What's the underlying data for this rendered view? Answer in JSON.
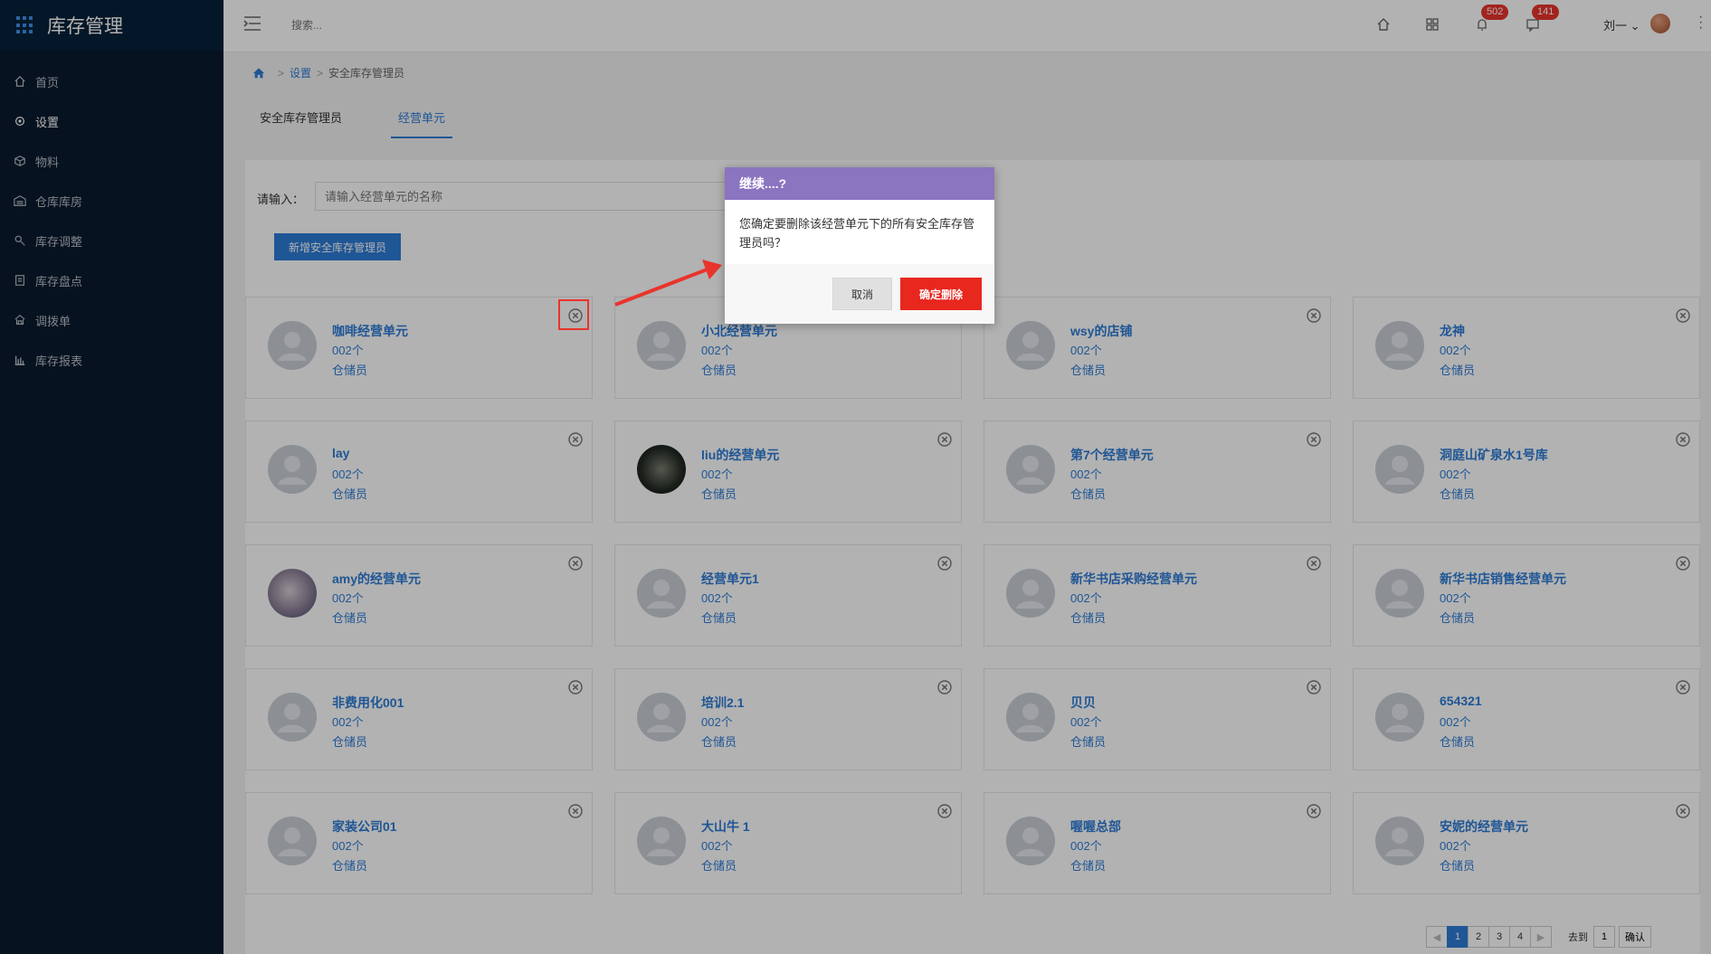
{
  "app": {
    "title": "库存管理"
  },
  "sidebar": {
    "items": [
      {
        "label": "首页",
        "icon": "home-icon"
      },
      {
        "label": "设置",
        "icon": "gear-icon"
      },
      {
        "label": "物料",
        "icon": "box-icon"
      },
      {
        "label": "仓库库房",
        "icon": "warehouse-icon"
      },
      {
        "label": "库存调整",
        "icon": "adjust-icon"
      },
      {
        "label": "库存盘点",
        "icon": "clipboard-icon"
      },
      {
        "label": "调拨单",
        "icon": "transfer-icon"
      },
      {
        "label": "库存报表",
        "icon": "bar-chart-icon"
      }
    ]
  },
  "topbar": {
    "search_placeholder": "搜索...",
    "notifications_count": "502",
    "messages_count": "141",
    "user_name": "刘一"
  },
  "breadcrumb": {
    "level1": "设置",
    "level2": "安全库存管理员"
  },
  "tabs": [
    {
      "label": "安全库存管理员"
    },
    {
      "label": "经营单元"
    }
  ],
  "filter": {
    "label": "请输入：",
    "placeholder": "请输入经营单元的名称",
    "add_button": "新增安全库存管理员"
  },
  "cards": [
    {
      "name": "咖啡经营单元",
      "count": "002个",
      "role": "仓储员",
      "avatar": "default"
    },
    {
      "name": "小北经营单元",
      "count": "002个",
      "role": "仓储员",
      "avatar": "default"
    },
    {
      "name": "wsy的店铺",
      "count": "002个",
      "role": "仓储员",
      "avatar": "default"
    },
    {
      "name": "龙神",
      "count": "002个",
      "role": "仓储员",
      "avatar": "default"
    },
    {
      "name": "lay",
      "count": "002个",
      "role": "仓储员",
      "avatar": "default"
    },
    {
      "name": "liu的经营单元",
      "count": "002个",
      "role": "仓储员",
      "avatar": "photo1"
    },
    {
      "name": "第7个经营单元",
      "count": "002个",
      "role": "仓储员",
      "avatar": "default"
    },
    {
      "name": "洞庭山矿泉水1号库",
      "count": "002个",
      "role": "仓储员",
      "avatar": "default"
    },
    {
      "name": "amy的经营单元",
      "count": "002个",
      "role": "仓储员",
      "avatar": "photo2"
    },
    {
      "name": "经营单元1",
      "count": "002个",
      "role": "仓储员",
      "avatar": "default"
    },
    {
      "name": "新华书店采购经营单元",
      "count": "002个",
      "role": "仓储员",
      "avatar": "default"
    },
    {
      "name": "新华书店销售经营单元",
      "count": "002个",
      "role": "仓储员",
      "avatar": "default"
    },
    {
      "name": "非费用化001",
      "count": "002个",
      "role": "仓储员",
      "avatar": "default"
    },
    {
      "name": "培训2.1",
      "count": "002个",
      "role": "仓储员",
      "avatar": "default"
    },
    {
      "name": "贝贝",
      "count": "002个",
      "role": "仓储员",
      "avatar": "default"
    },
    {
      "name": "654321",
      "count": "002个",
      "role": "仓储员",
      "avatar": "default"
    },
    {
      "name": "家装公司01",
      "count": "002个",
      "role": "仓储员",
      "avatar": "default"
    },
    {
      "name": "大山牛 1",
      "count": "002个",
      "role": "仓储员",
      "avatar": "default"
    },
    {
      "name": "喔喔总部",
      "count": "002个",
      "role": "仓储员",
      "avatar": "default"
    },
    {
      "name": "安妮的经营单元",
      "count": "002个",
      "role": "仓储员",
      "avatar": "default"
    }
  ],
  "pagination": {
    "pages": [
      "1",
      "2",
      "3",
      "4"
    ],
    "current": "1",
    "goto_label": "去到",
    "goto_value": "1",
    "confirm_label": "确认"
  },
  "dialog": {
    "title": "继续....?",
    "message": "您确定要删除该经营单元下的所有安全库存管理员吗？",
    "cancel_label": "取消",
    "confirm_label": "确定删除"
  },
  "colors": {
    "sidebar_bg": "#0a1a2e",
    "accent": "#2d7bd6",
    "dialog_header": "#8b74c0",
    "danger": "#e8271f",
    "badge": "#e9342c"
  }
}
